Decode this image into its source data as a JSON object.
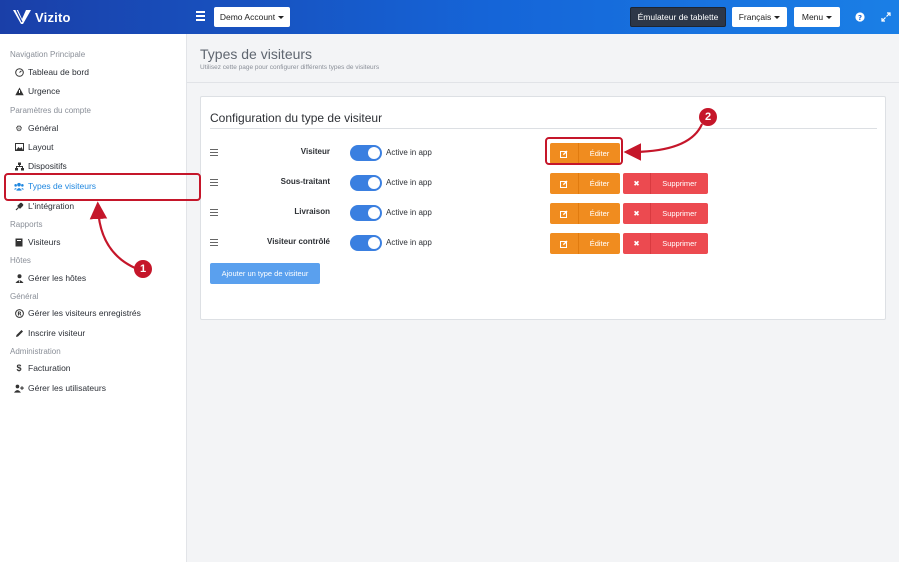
{
  "app": {
    "name": "Vizito"
  },
  "topbar": {
    "account_label": "Demo Account",
    "tablet_emulator_label": "Émulateur de tablette",
    "language_label": "Français",
    "menu_label": "Menu",
    "help_icon": "question-icon",
    "expand_icon": "expand-icon"
  },
  "sidebar": {
    "sections": [
      {
        "title": "Navigation Principale",
        "items": [
          {
            "label": "Tableau de bord",
            "icon": "gauge-icon"
          },
          {
            "label": "Urgence",
            "icon": "warning-icon"
          }
        ]
      },
      {
        "title": "Paramètres du compte",
        "items": [
          {
            "label": "Général",
            "icon": "gear-icon"
          },
          {
            "label": "Layout",
            "icon": "image-icon"
          },
          {
            "label": "Dispositifs",
            "icon": "sitemap-icon"
          },
          {
            "label": "Types de visiteurs",
            "icon": "users-icon",
            "active": true
          },
          {
            "label": "L'intégration",
            "icon": "plug-icon"
          }
        ]
      },
      {
        "title": "Rapports",
        "items": [
          {
            "label": "Visiteurs",
            "icon": "book-icon"
          }
        ]
      },
      {
        "title": "Hôtes",
        "items": [
          {
            "label": "Gérer les hôtes",
            "icon": "user-tie-icon"
          }
        ]
      },
      {
        "title": "Général",
        "items": [
          {
            "label": "Gérer les visiteurs enregistrés",
            "icon": "registered-icon"
          },
          {
            "label": "Inscrire visiteur",
            "icon": "pencil-icon"
          }
        ]
      },
      {
        "title": "Administration",
        "items": [
          {
            "label": "Facturation",
            "icon": "dollar-icon"
          },
          {
            "label": "Gérer les utilisateurs",
            "icon": "user-plus-icon"
          }
        ]
      }
    ]
  },
  "page": {
    "title": "Types de visiteurs",
    "subtitle": "Utilisez cette page pour configurer différents types de visiteurs"
  },
  "card": {
    "title": "Configuration du type de visiteur",
    "toggle_label": "Active in app",
    "edit_label": "Éditer",
    "delete_label": "Supprimer",
    "add_label": "Ajouter un type de visiteur",
    "rows": [
      {
        "name": "Visiteur",
        "active": true,
        "deletable": false
      },
      {
        "name": "Sous-traitant",
        "active": true,
        "deletable": true
      },
      {
        "name": "Livraison",
        "active": true,
        "deletable": true
      },
      {
        "name": "Visiteur contrôlé",
        "active": true,
        "deletable": true
      }
    ]
  },
  "annotations": {
    "badge1": "1",
    "badge2": "2",
    "color": "#c5162a"
  }
}
